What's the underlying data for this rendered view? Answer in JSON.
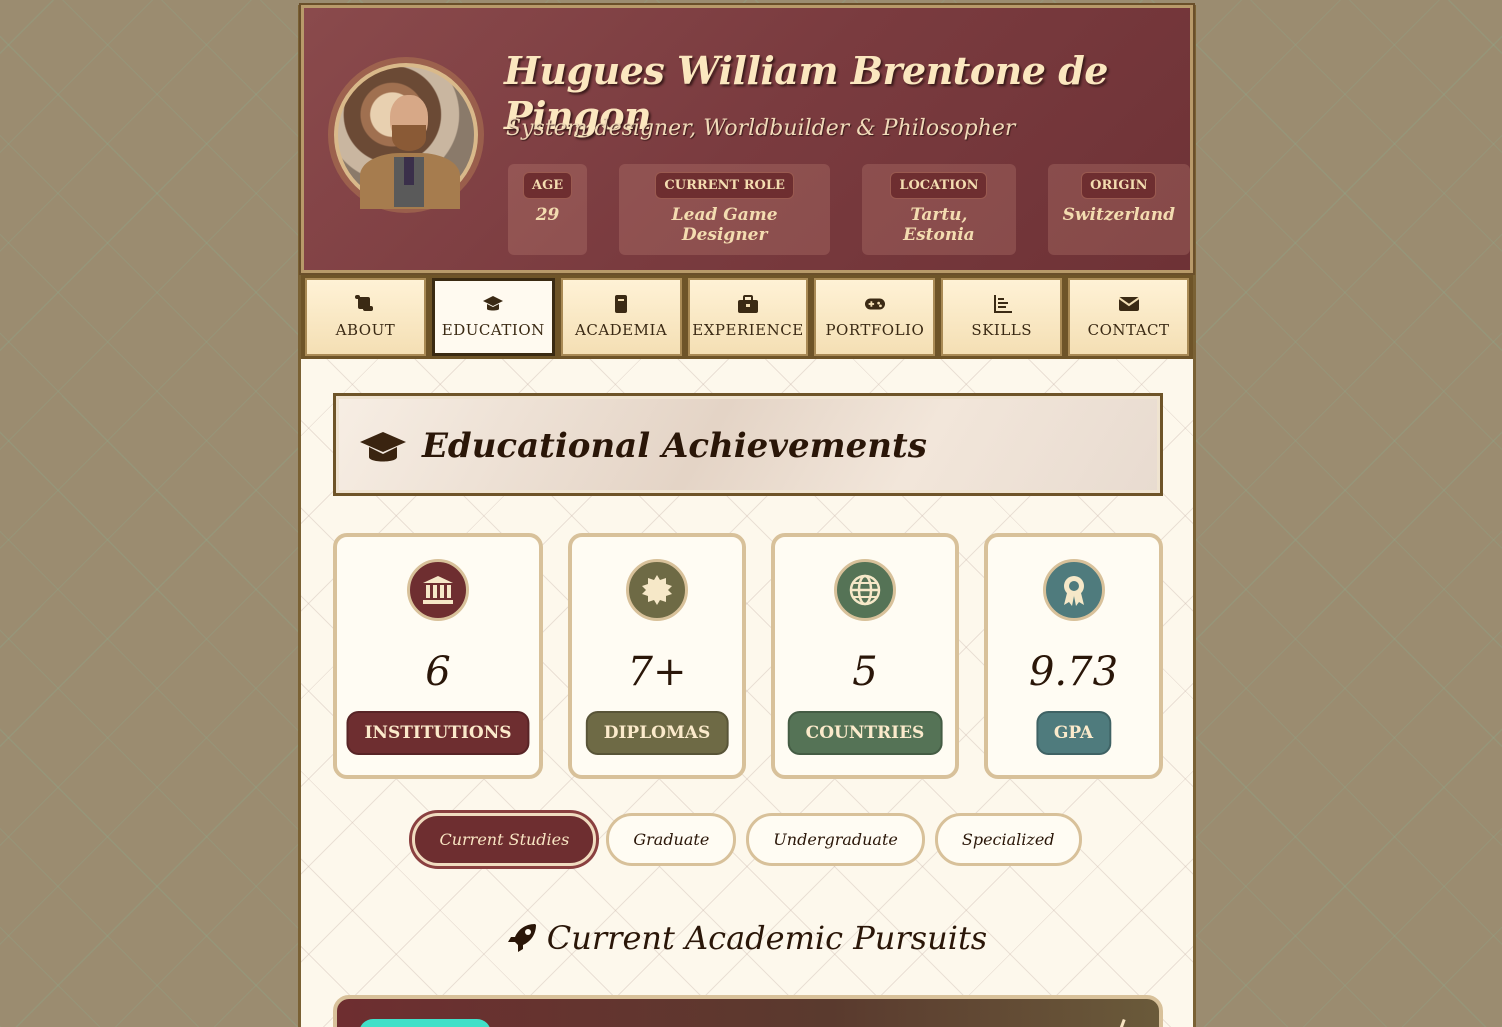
{
  "profile": {
    "name": "Hugues William Brentone de Pingon",
    "subtitle": "System designer, Worldbuilder & Philosopher",
    "facts": [
      {
        "label": "AGE",
        "value": "29"
      },
      {
        "label": "CURRENT ROLE",
        "value": "Lead Game Designer"
      },
      {
        "label": "LOCATION",
        "value": "Tartu, Estonia"
      },
      {
        "label": "ORIGIN",
        "value": "Switzerland"
      }
    ]
  },
  "nav": {
    "tabs": [
      {
        "label": "ABOUT",
        "icon": "scroll-icon"
      },
      {
        "label": "EDUCATION",
        "icon": "graduation-cap-icon",
        "active": true
      },
      {
        "label": "ACADEMIA",
        "icon": "book-icon"
      },
      {
        "label": "EXPERIENCE",
        "icon": "briefcase-icon"
      },
      {
        "label": "PORTFOLIO",
        "icon": "gamepad-icon"
      },
      {
        "label": "SKILLS",
        "icon": "chart-icon"
      },
      {
        "label": "CONTACT",
        "icon": "envelope-icon"
      }
    ]
  },
  "section": {
    "title": "Educational Achievements",
    "stats": [
      {
        "value": "6",
        "label": "INSTITUTIONS",
        "icon": "university-icon",
        "color": "#6e2e30"
      },
      {
        "value": "7+",
        "label": "DIPLOMAS",
        "icon": "certificate-icon",
        "color": "#6e6a45"
      },
      {
        "value": "5",
        "label": "COUNTRIES",
        "icon": "globe-icon",
        "color": "#557356"
      },
      {
        "value": "9.73",
        "label": "GPA",
        "icon": "award-icon",
        "color": "#4f7b7d"
      }
    ],
    "filters": [
      "Current Studies",
      "Graduate",
      "Undergraduate",
      "Specialized"
    ],
    "active_filter": "Current Studies",
    "pursuits_title": "Current Academic Pursuits"
  },
  "colors": {
    "header_bg": "#7a3b3f",
    "accent_gold": "#d8c19a",
    "text_dark": "#2a1608"
  }
}
